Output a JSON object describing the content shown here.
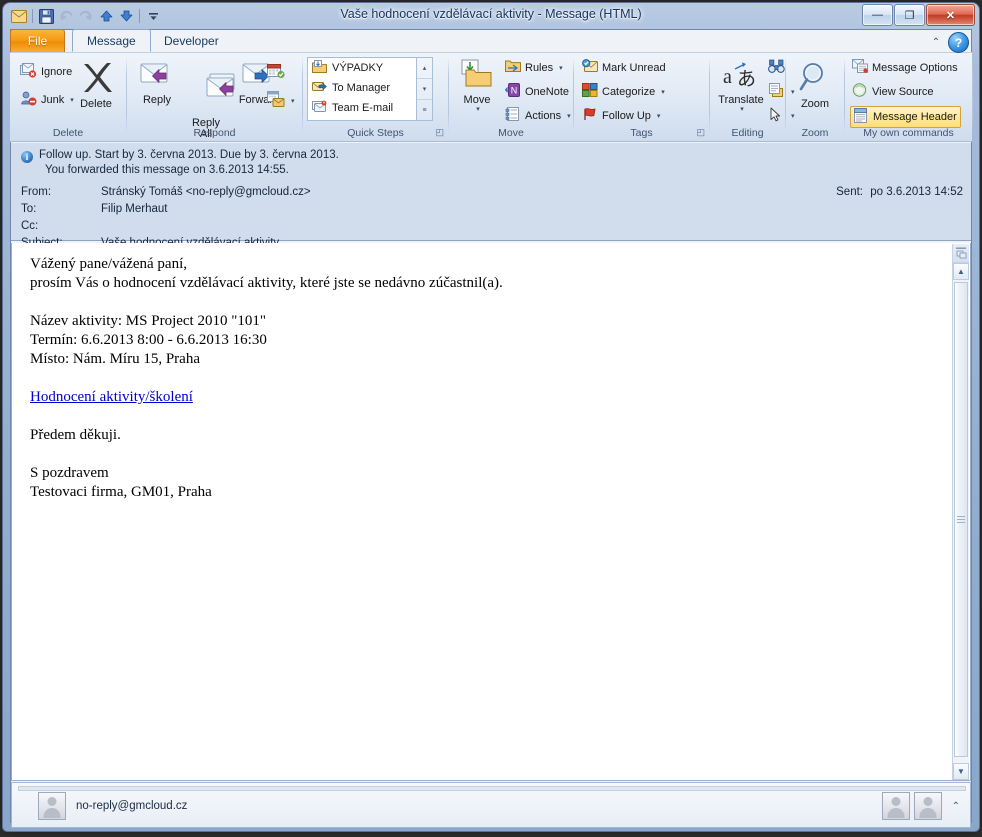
{
  "window": {
    "title": "Vaše hodnocení vzdělávací aktivity  -  Message (HTML)",
    "minimize": "—",
    "maximize": "❐",
    "close": "✕"
  },
  "quick_access": {
    "items": [
      {
        "name": "message-icon",
        "glyph": "✉"
      },
      {
        "name": "save-icon",
        "glyph": "💾"
      },
      {
        "name": "undo-icon",
        "glyph": "↺"
      },
      {
        "name": "redo-icon",
        "glyph": "↻"
      },
      {
        "name": "previous-item-icon",
        "glyph": "▲"
      },
      {
        "name": "next-item-icon",
        "glyph": "▼"
      },
      {
        "name": "customize-qat-icon",
        "glyph": "▼"
      }
    ]
  },
  "tabs": [
    {
      "label": "File",
      "id": "file"
    },
    {
      "label": "Message",
      "id": "message"
    },
    {
      "label": "Developer",
      "id": "developer"
    }
  ],
  "ribbon": {
    "collapse_glyph": "⌃",
    "help_glyph": "?",
    "groups": {
      "delete": {
        "label": "Delete",
        "ignore": "Ignore",
        "junk": "Junk",
        "junk_arrow": "▾",
        "delete": "Delete"
      },
      "respond": {
        "label": "Respond",
        "reply": "Reply",
        "reply_all": "Reply\nAll",
        "forward": "Forward",
        "more_arrow": "▾"
      },
      "quick_steps": {
        "label": "Quick Steps",
        "launcher": "◰",
        "items": [
          {
            "label": "VÝPADKY"
          },
          {
            "label": "To Manager"
          },
          {
            "label": "Team E-mail"
          }
        ],
        "scroll_up": "▴",
        "scroll_down": "▾",
        "scroll_more": "≡"
      },
      "move": {
        "label": "Move",
        "move": "Move",
        "move_arrow": "▾",
        "rules": "Rules",
        "rules_arrow": "▾",
        "onenote": "OneNote",
        "actions": "Actions",
        "actions_arrow": "▾"
      },
      "tags": {
        "label": "Tags",
        "launcher": "◰",
        "mark_unread": "Mark Unread",
        "categorize": "Categorize",
        "categorize_arrow": "▾",
        "follow_up": "Follow Up",
        "follow_up_arrow": "▾"
      },
      "editing": {
        "label": "Editing",
        "translate": "Translate",
        "translate_arrow": "▾",
        "find_arrow": "▾",
        "replace_arrow": "▾",
        "select_arrow": "▾"
      },
      "zoom": {
        "label": "Zoom",
        "zoom": "Zoom"
      },
      "my_commands": {
        "label": "My own commands",
        "message_options": "Message Options",
        "view_source": "View Source",
        "message_header": "Message Header"
      }
    }
  },
  "message_header": {
    "info_line1": "Follow up.  Start by 3. června 2013.  Due by 3. června 2013.",
    "info_line2": "You forwarded this message on 3.6.2013 14:55.",
    "info_glyph": "i",
    "fields": [
      {
        "label": "From:",
        "value": "Stránský Tomáš <no-reply@gmcloud.cz>"
      },
      {
        "label": "To:",
        "value": "Filip Merhaut"
      },
      {
        "label": "Cc:",
        "value": ""
      },
      {
        "label": "Subject:",
        "value": "Vaše hodnocení vzdělávací aktivity"
      }
    ],
    "sent_label": "Sent:",
    "sent_value": "po 3.6.2013 14:52"
  },
  "body": {
    "part1": "Vážený pane/vážená paní,\nprosím Vás o hodnocení vzdělávací aktivity, které jste se nedávno zúčastnil(a).\n\nNázev aktivity: MS Project 2010 \"101\"\nTermín: 6.6.2013 8:00 - 6.6.2013 16:30\nMísto: Nám. Míru 15, Praha\n\n",
    "link": "Hodnocení aktivity/školení",
    "part2": "\n\nPředem děkuji.\n\nS pozdravem\nTestovaci firma, GM01, Praha"
  },
  "scrollbar": {
    "split_glyph": "▣",
    "up_glyph": "▲",
    "down_glyph": "▼"
  },
  "people_pane": {
    "address": "no-reply@gmcloud.cz",
    "expand_glyph": "⌃"
  }
}
